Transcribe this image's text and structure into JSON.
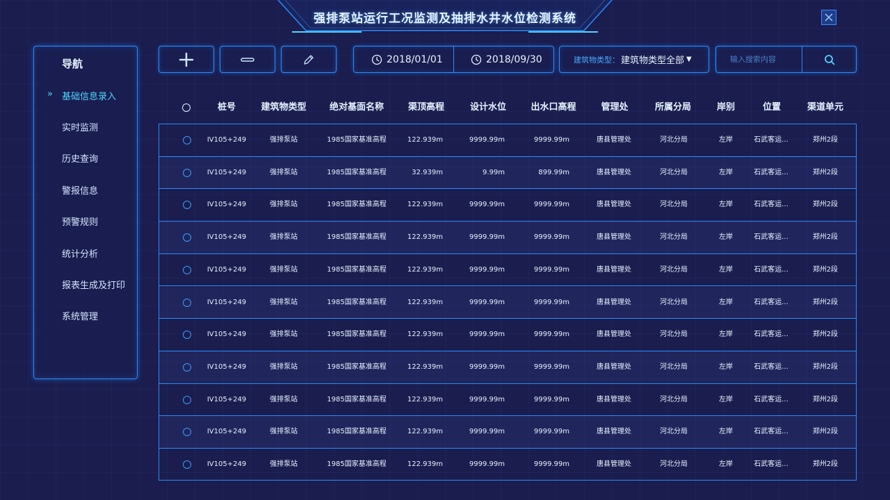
{
  "header": {
    "title": "强排泵站运行工况监测及抽排水井水位检测系统",
    "close_icon": "close-icon"
  },
  "nav": {
    "title": "导航",
    "active_index": 0,
    "items": [
      {
        "label": "基础信息录入"
      },
      {
        "label": "实时监测"
      },
      {
        "label": "历史查询"
      },
      {
        "label": "警报信息"
      },
      {
        "label": "预警规则"
      },
      {
        "label": "统计分析"
      },
      {
        "label": "报表生成及打印"
      },
      {
        "label": "系统管理"
      }
    ]
  },
  "toolbar": {
    "add_icon": "plus-icon",
    "remove_icon": "minus-icon",
    "edit_icon": "pencil-icon",
    "start_date": "2018/01/01",
    "end_date": "2018/09/30",
    "building_type_label": "建筑物类型：",
    "building_type_value": "建筑物类型全部",
    "search_placeholder": "输入搜索内容",
    "search_icon": "search-icon"
  },
  "table": {
    "columns": [
      "桩号",
      "建筑物类型",
      "绝对基面名称",
      "渠顶高程",
      "设计水位",
      "出水口高程",
      "管理处",
      "所属分局",
      "岸别",
      "位置",
      "渠道单元"
    ],
    "rows": [
      [
        "IV105+249",
        "强排泵站",
        "1985国家基准高程",
        "122.939m",
        "9999.99m",
        "9999.99m",
        "唐县管理处",
        "河北分局",
        "左岸",
        "石武客运...",
        "郑州2段"
      ],
      [
        "IV105+249",
        "强排泵站",
        "1985国家基准高程",
        "32.939m",
        "9.99m",
        "899.99m",
        "唐县管理处",
        "河北分局",
        "左岸",
        "石武客运...",
        "郑州2段"
      ],
      [
        "IV105+249",
        "强排泵站",
        "1985国家基准高程",
        "122.939m",
        "9999.99m",
        "9999.99m",
        "唐县管理处",
        "河北分局",
        "左岸",
        "石武客运...",
        "郑州2段"
      ],
      [
        "IV105+249",
        "强排泵站",
        "1985国家基准高程",
        "122.939m",
        "9999.99m",
        "9999.99m",
        "唐县管理处",
        "河北分局",
        "左岸",
        "石武客运...",
        "郑州2段"
      ],
      [
        "IV105+249",
        "强排泵站",
        "1985国家基准高程",
        "122.939m",
        "9999.99m",
        "9999.99m",
        "唐县管理处",
        "河北分局",
        "左岸",
        "石武客运...",
        "郑州2段"
      ],
      [
        "IV105+249",
        "强排泵站",
        "1985国家基准高程",
        "122.939m",
        "9999.99m",
        "9999.99m",
        "唐县管理处",
        "河北分局",
        "左岸",
        "石武客运...",
        "郑州2段"
      ],
      [
        "IV105+249",
        "强排泵站",
        "1985国家基准高程",
        "122.939m",
        "9999.99m",
        "9999.99m",
        "唐县管理处",
        "河北分局",
        "左岸",
        "石武客运...",
        "郑州2段"
      ],
      [
        "IV105+249",
        "强排泵站",
        "1985国家基准高程",
        "122.939m",
        "9999.99m",
        "9999.99m",
        "唐县管理处",
        "河北分局",
        "左岸",
        "石武客运...",
        "郑州2段"
      ],
      [
        "IV105+249",
        "强排泵站",
        "1985国家基准高程",
        "122.939m",
        "9999.99m",
        "9999.99m",
        "唐县管理处",
        "河北分局",
        "左岸",
        "石武客运...",
        "郑州2段"
      ],
      [
        "IV105+249",
        "强排泵站",
        "1985国家基准高程",
        "122.939m",
        "9999.99m",
        "9999.99m",
        "唐县管理处",
        "河北分局",
        "左岸",
        "石武客运...",
        "郑州2段"
      ],
      [
        "IV105+249",
        "强排泵站",
        "1985国家基准高程",
        "122.939m",
        "9999.99m",
        "9999.99m",
        "唐县管理处",
        "河北分局",
        "左岸",
        "石武客运...",
        "郑州2段"
      ]
    ]
  },
  "colors": {
    "background": "#1a1d4e",
    "accent": "#2a8cff",
    "active_nav": "#52d5ff"
  }
}
